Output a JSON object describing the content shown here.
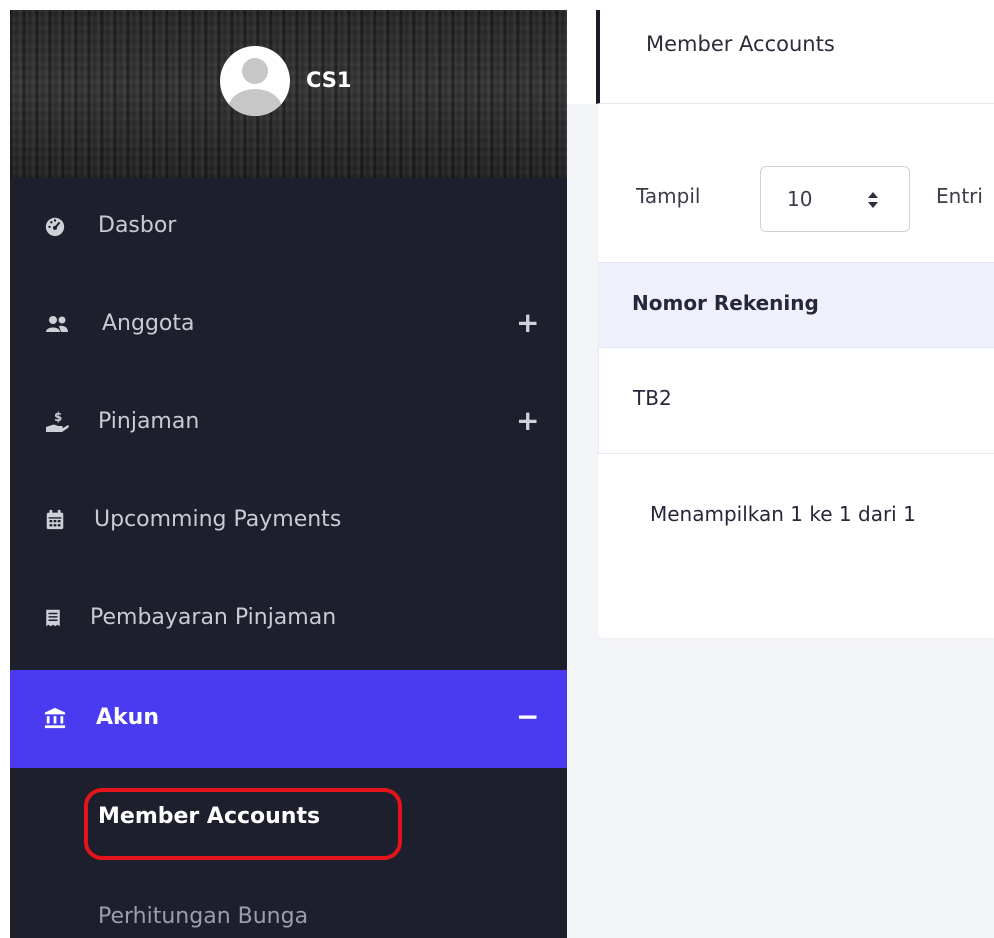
{
  "user": {
    "name": "CS1"
  },
  "sidebar": {
    "items": [
      {
        "label": "Dasbor",
        "icon": "gauge-icon",
        "toggle": ""
      },
      {
        "label": "Anggota",
        "icon": "users-icon",
        "toggle": "+"
      },
      {
        "label": "Pinjaman",
        "icon": "hand-dollar-icon",
        "toggle": "+"
      },
      {
        "label": "Upcomming Payments",
        "icon": "calendar-icon",
        "toggle": ""
      },
      {
        "label": "Pembayaran Pinjaman",
        "icon": "receipt-icon",
        "toggle": ""
      },
      {
        "label": "Akun",
        "icon": "bank-icon",
        "toggle": "−",
        "active": true
      }
    ],
    "sub_items": [
      {
        "label": "Member Accounts",
        "current": true
      },
      {
        "label": "Perhitungan Bunga",
        "current": false
      }
    ]
  },
  "header": {
    "title": "Member Accounts"
  },
  "table": {
    "show_label": "Tampil",
    "page_size": "10",
    "entries_label": "Entri",
    "columns": [
      "Nomor Rekening"
    ],
    "rows": [
      [
        "TB2"
      ]
    ],
    "info": "Menampilkan 1 ke 1 dari 1"
  },
  "colors": {
    "sidebar_bg": "#1e1f2c",
    "active_item": "#4b3bf0",
    "highlight_ring": "#e3141c"
  }
}
